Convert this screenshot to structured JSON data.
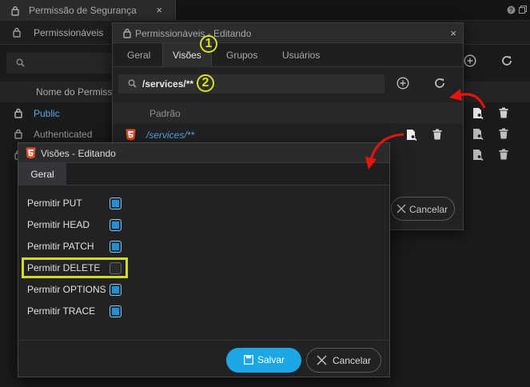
{
  "background": {
    "tab_title": "Permissão de Segurança",
    "subtab_label": "Permissionáveis",
    "column_header": "Nome do Permissionável",
    "rows": [
      {
        "label": "Public",
        "color": "#5aa8e8"
      },
      {
        "label": "Authenticated",
        "color": "#9a9a9a"
      }
    ]
  },
  "dialog1": {
    "title": "Permissionáveis - Editando",
    "tabs": [
      "Geral",
      "Visões",
      "Grupos",
      "Usuários"
    ],
    "active_tab": "Visões",
    "search_value": "/services/**",
    "column_header": "Padrão",
    "row_label": "/services/**",
    "cancel_label": "Cancelar"
  },
  "dialog2": {
    "title": "Visões - Editando",
    "tab": "Geral",
    "permissions": [
      {
        "label": "Permitir PUT",
        "checked": true
      },
      {
        "label": "Permitir HEAD",
        "checked": true
      },
      {
        "label": "Permitir PATCH",
        "checked": true
      },
      {
        "label": "Permitir DELETE",
        "checked": false
      },
      {
        "label": "Permitir OPTIONS",
        "checked": true
      },
      {
        "label": "Permitir TRACE",
        "checked": true
      }
    ],
    "save_label": "Salvar",
    "cancel_label": "Cancelar"
  },
  "annotations": {
    "step1": "1",
    "step2": "2",
    "highlight_color": "#d8e21a",
    "arrow_color": "#e8140c"
  }
}
